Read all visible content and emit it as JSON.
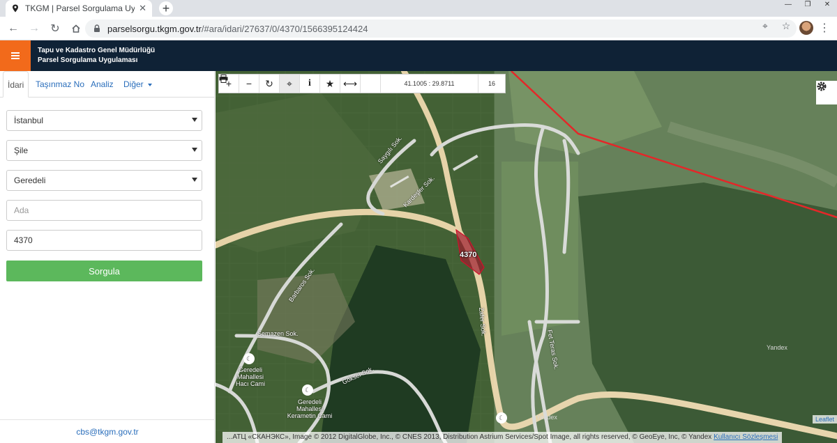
{
  "browser": {
    "tab_title": "TKGM | Parsel Sorgulama Uygula",
    "url_host": "parselsorgu.tkgm.gov.tr",
    "url_path": "/#ara/idari/27637/0/4370/1566395124424"
  },
  "app": {
    "brand_line1": "Tapu ve Kadastro Genel Müdürlüğü",
    "brand_line2": "Parsel Sorgulama Uygulaması"
  },
  "sidebar": {
    "tabs": [
      "İdari",
      "Taşınmaz No",
      "Analiz",
      "Diğer"
    ],
    "province": "İstanbul",
    "district": "Şile",
    "neighborhood": "Geredeli",
    "ada_placeholder": "Ada",
    "parsel_value": "4370",
    "submit_label": "Sorgula",
    "footer_email": "cbs@tkgm.gov.tr"
  },
  "map": {
    "coordinates": "41.1005 : 29.8711",
    "zoom": "16",
    "parcel_label": "4370",
    "streets": [
      "Saygılı Sok.",
      "Kardeşler Sok.",
      "Barbaros Sok.",
      "Semazen Sok.",
      "Göksel Sok.",
      "Fet Teras Sok.",
      "Zafer Sok."
    ],
    "poi": [
      {
        "line1": "Geredeli",
        "line2": "Mahallesi",
        "line3": "Hacı Cami"
      },
      {
        "line1": "Geredeli",
        "line2": "Mahallesi",
        "line3": "Kerametin Cami"
      }
    ],
    "watermark": "Yandex",
    "attribution_text": "...АТЦ «СКАНЭКС», Image © 2012 DigitalGlobe, Inc., © CNES 2013, Distribution Astrium Services/Spot Image, all rights reserved, © GeoEye, Inc, © Yandex",
    "attribution_link": "Kullanıcı Sözleşmesi",
    "leaflet_label": "Leaflet"
  }
}
